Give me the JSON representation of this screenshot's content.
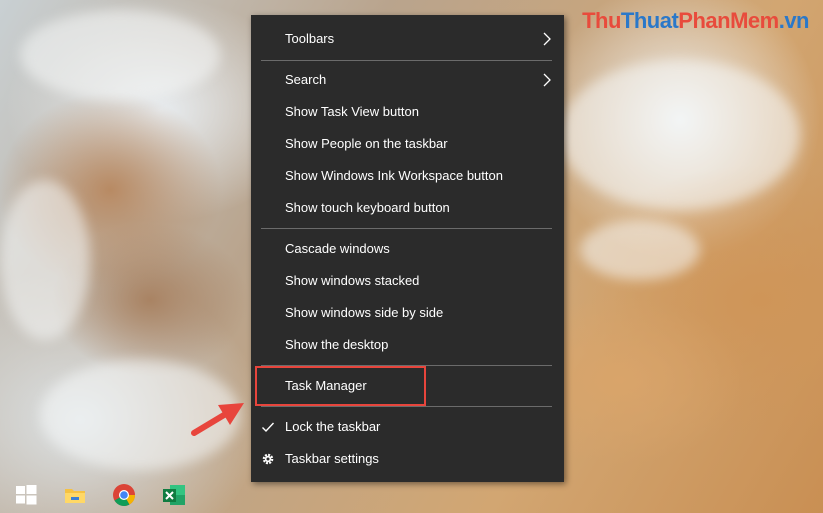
{
  "watermark": {
    "part_a": "Thu",
    "part_b": "Thuat",
    "part_c": "PhanMem",
    "part_d": ".vn"
  },
  "context_menu": {
    "items": [
      {
        "label": "Toolbars",
        "submenu": true
      },
      {
        "label": "Search",
        "submenu": true
      },
      {
        "label": "Show Task View button"
      },
      {
        "label": "Show People on the taskbar"
      },
      {
        "label": "Show Windows Ink Workspace button"
      },
      {
        "label": "Show touch keyboard button"
      },
      {
        "label": "Cascade windows"
      },
      {
        "label": "Show windows stacked"
      },
      {
        "label": "Show windows side by side"
      },
      {
        "label": "Show the desktop"
      },
      {
        "label": "Task Manager",
        "highlighted": true
      },
      {
        "label": "Lock the taskbar",
        "checked": true
      },
      {
        "label": "Taskbar settings",
        "icon": "gear-icon"
      }
    ]
  },
  "taskbar": {
    "icons": [
      "windows-start-icon",
      "file-explorer-icon",
      "chrome-icon",
      "excel-icon"
    ]
  },
  "colors": {
    "menu_bg": "#2b2b2b",
    "highlight": "#e8453c",
    "separator": "#6b6b6b"
  }
}
